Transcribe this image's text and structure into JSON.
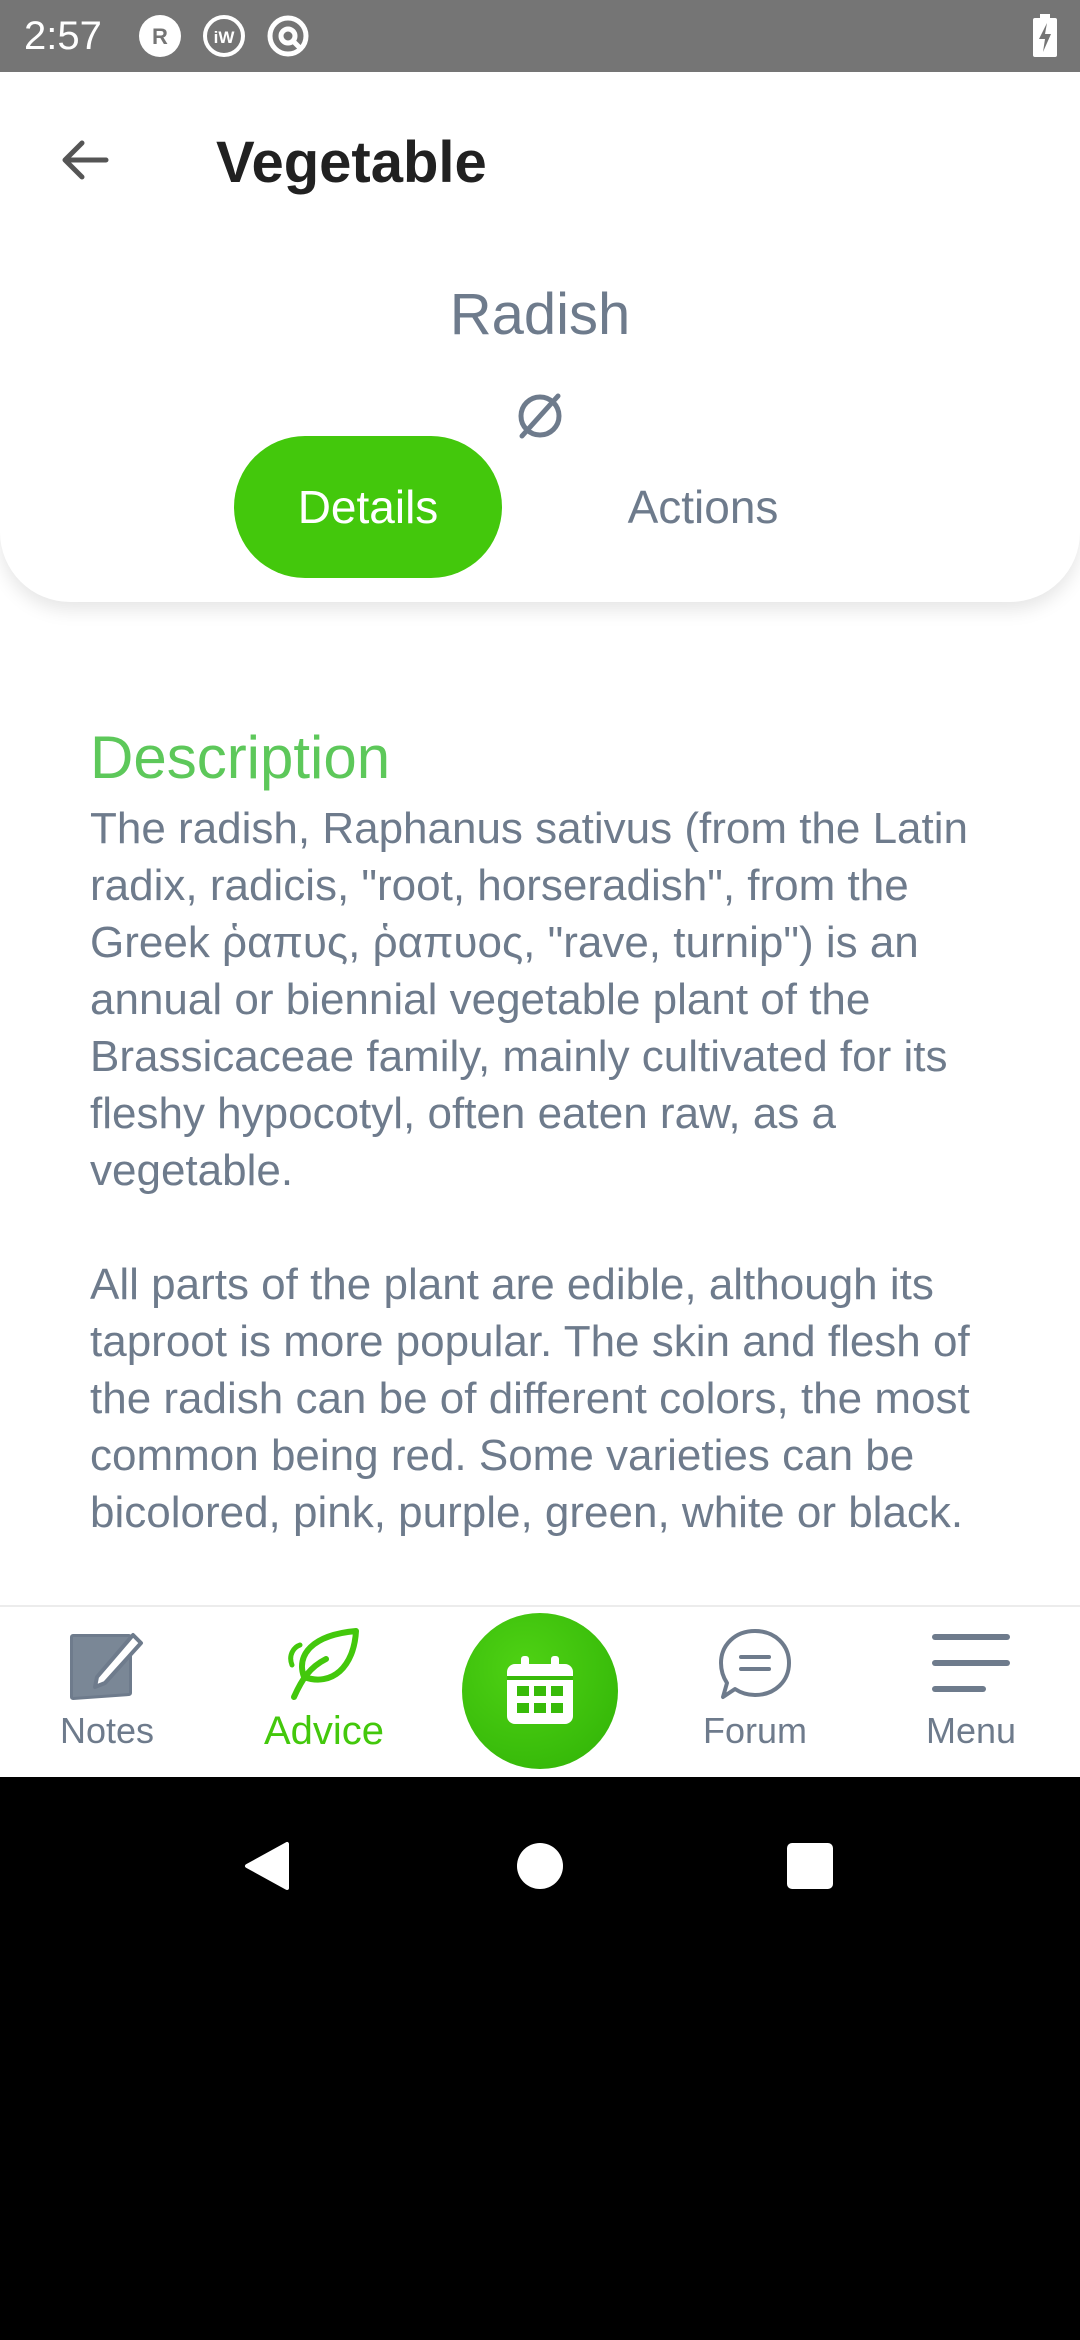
{
  "status_bar": {
    "time": "2:57",
    "icons": [
      "r-circle-icon",
      "iw-circle-icon",
      "at-circle-icon"
    ],
    "battery": "battery-charging-icon"
  },
  "header": {
    "title": "Vegetable",
    "back_icon": "arrow-left-icon"
  },
  "plant": {
    "name": "Radish",
    "status_icon": "empty-set-icon"
  },
  "tabs": [
    {
      "label": "Details",
      "active": true
    },
    {
      "label": "Actions",
      "active": false
    }
  ],
  "description": {
    "heading": "Description",
    "paragraphs": [
      "The radish, Raphanus sativus (from the Latin radix, radicis, \"root, horseradish\", from the Greek ῥαπυς, ῥαπυος, \"rave, turnip\") is an annual or biennial vegetable plant of the Brassicaceae family, mainly cultivated for its fleshy hypocotyl, often eaten raw, as a vegetable.",
      "All parts of the plant are edible, although its taproot is more popular. The skin and flesh of the radish can be of different colors, the most common being red. Some varieties can be bicolored, pink, purple, green, white or black."
    ]
  },
  "bottom_nav": {
    "items": [
      {
        "label": "Notes",
        "icon": "notepad-pencil-icon",
        "active": false
      },
      {
        "label": "Advice",
        "icon": "leaf-icon",
        "active": true
      },
      {
        "label": "Forum",
        "icon": "chat-bubble-icon",
        "active": false
      },
      {
        "label": "Menu",
        "icon": "hamburger-menu-icon",
        "active": false
      }
    ],
    "center_button_icon": "calendar-icon"
  },
  "system_nav": [
    "back-triangle-icon",
    "home-circle-icon",
    "recents-square-icon"
  ],
  "colors": {
    "accent": "#43c80c",
    "heading_green": "#5dc85a",
    "text_gray": "#6e7b8c",
    "status_bar": "#757575"
  }
}
